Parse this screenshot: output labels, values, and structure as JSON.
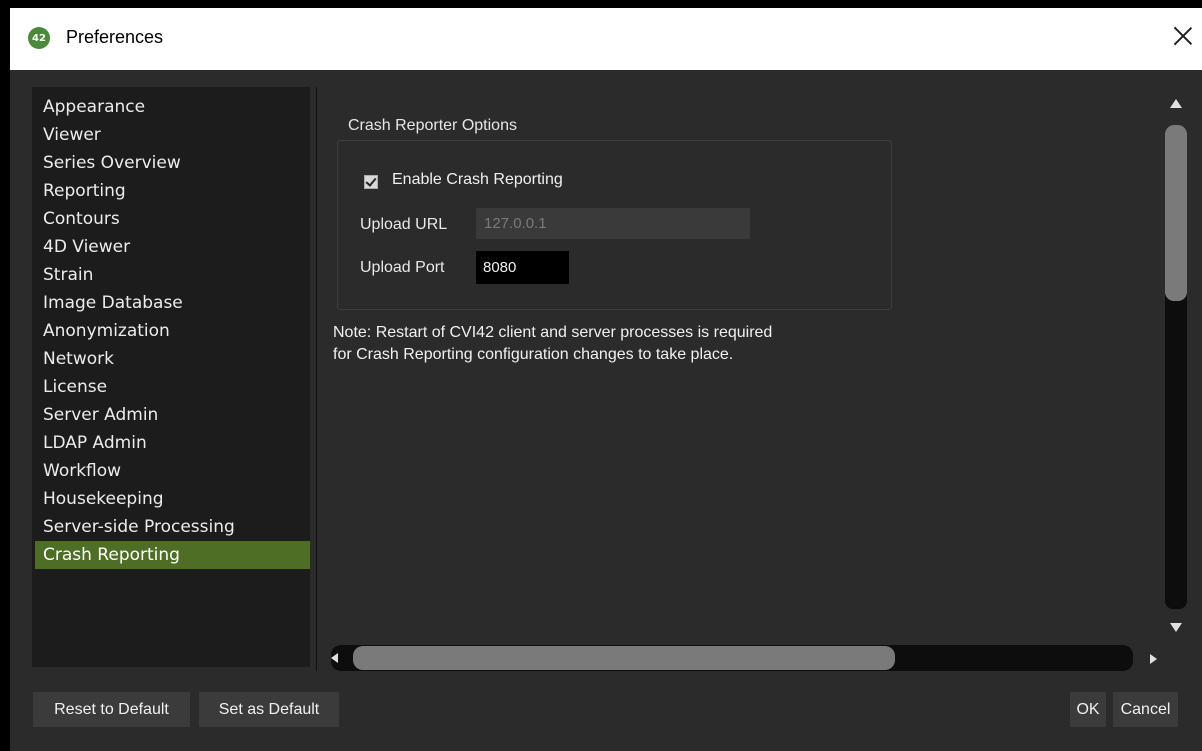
{
  "window": {
    "title": "Preferences",
    "app_icon_text": "42"
  },
  "sidebar": {
    "items": [
      {
        "label": "Appearance"
      },
      {
        "label": "Viewer"
      },
      {
        "label": "Series Overview"
      },
      {
        "label": "Reporting"
      },
      {
        "label": "Contours"
      },
      {
        "label": "4D Viewer"
      },
      {
        "label": "Strain"
      },
      {
        "label": "Image Database"
      },
      {
        "label": "Anonymization"
      },
      {
        "label": "Network"
      },
      {
        "label": "License"
      },
      {
        "label": "Server Admin"
      },
      {
        "label": "LDAP Admin"
      },
      {
        "label": "Workflow"
      },
      {
        "label": "Housekeeping"
      },
      {
        "label": "Server-side Processing"
      },
      {
        "label": "Crash Reporting"
      }
    ],
    "selected": "Crash Reporting"
  },
  "crash_reporter": {
    "group_title": "Crash Reporter Options",
    "enable_label": "Enable Crash Reporting",
    "enable_checked": true,
    "url_label": "Upload URL",
    "url_value": "127.0.0.1",
    "port_label": "Upload Port",
    "port_value": "8080",
    "note_line1": "Note: Restart of CVI42 client and server processes is required",
    "note_line2": "for Crash Reporting configuration changes to take place."
  },
  "buttons": {
    "reset": "Reset to Default",
    "set_default": "Set as Default",
    "ok": "OK",
    "cancel": "Cancel"
  },
  "colors": {
    "selected_bg": "#4e6e26",
    "window_bg": "#2b2b2b",
    "sidebar_bg": "#1c1c1c"
  }
}
